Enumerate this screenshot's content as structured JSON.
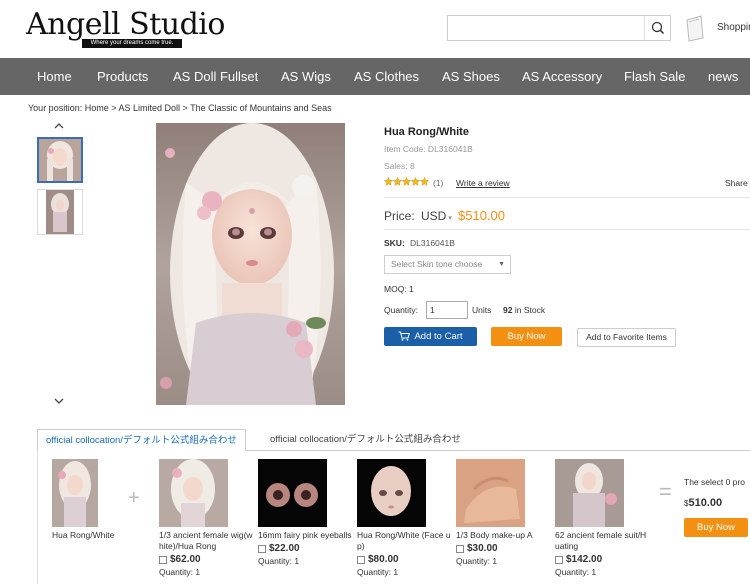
{
  "header": {
    "logo_text": "Angell Studio",
    "logo_tagline": "Where your dreams come true.",
    "search_placeholder": "",
    "cart_label": "Shoppin"
  },
  "nav": {
    "items": [
      "Home",
      "Products",
      "AS Doll Fullset",
      "AS Wigs",
      "AS Clothes",
      "AS Shoes",
      "AS Accessory",
      "Flash Sale",
      "news"
    ]
  },
  "breadcrumb": "Your position: Home > AS Limited Doll > The Classic of Mountains and Seas",
  "product": {
    "title": "Hua Rong/White",
    "item_code": "Item Code: DL316041B",
    "sales": "Sales: 8",
    "rating": 5,
    "review_count": "(1)",
    "write_review": "Write a review",
    "share": "Share",
    "price_label": "Price:",
    "currency": "USD",
    "price": "$510.00",
    "sku_label": "SKU:",
    "sku_value": "DL316041B",
    "skin_select_placeholder": "Select Skin tone choose",
    "moq": "MOQ: 1",
    "quantity_label": "Quantity:",
    "quantity_value": "1",
    "units_label": "Units",
    "stock_count": "92",
    "stock_suffix": "in Stock",
    "add_to_cart": "Add to Cart",
    "buy_now": "Buy Now",
    "add_favorite": "Add to Favorite Items"
  },
  "tabs": {
    "active": "official collocation/デフォルト公式組み合わせ",
    "inactive": "official collocation/デフォルト公式組み合わせ"
  },
  "collocation": {
    "main_item_name": "Hua Rong/White",
    "items": [
      {
        "name": "1/3 ancient female wig(white)/Hua Rong",
        "price": "$62.00",
        "qty": "Quantity: 1"
      },
      {
        "name": "16mm fairy pink eyeballs",
        "price": "$22.00",
        "qty": "Quantity: 1"
      },
      {
        "name": "Hua Rong/White (Face up)",
        "price": "$80.00",
        "qty": "Quantity: 1"
      },
      {
        "name": "1/3 Body make-up A",
        "price": "$30.00",
        "qty": "Quantity: 1"
      },
      {
        "name": "62 ancient female suit/Huating",
        "price": "$142.00",
        "qty": "Quantity: 1"
      }
    ],
    "select_text": "The select 0 pro",
    "total_currency": "$",
    "total_value": "510.00",
    "buy_now": "Buy Now"
  },
  "colors": {
    "nav_bg": "#666666",
    "accent_orange": "#f39012",
    "accent_blue": "#1a5fa8",
    "tab_active": "#1a6cb8"
  }
}
